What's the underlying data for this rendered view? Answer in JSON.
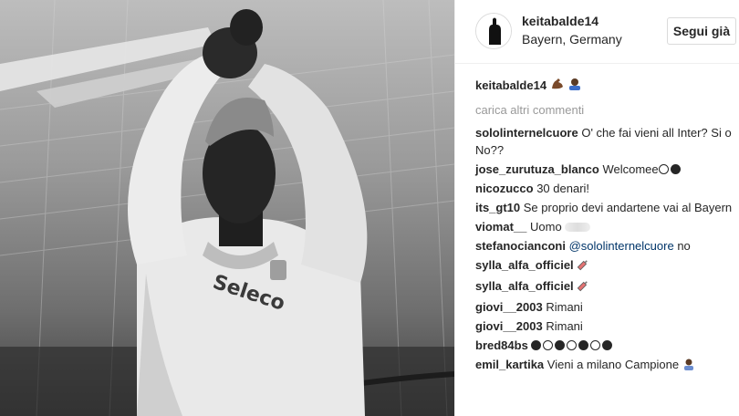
{
  "post": {
    "username": "keitabalde14",
    "location": "Bayern, Germany",
    "follow_label": "Segui già"
  },
  "caption": {
    "username": "keitabalde14",
    "emoji_1": "flexed-biceps-emoji",
    "emoji_2": "person-bowing-emoji"
  },
  "load_more_label": "carica altri commenti",
  "comments": [
    {
      "user": "sololinternelcuore",
      "text": "O' che fai vieni all Inter? Si o No??"
    },
    {
      "user": "jose_zurutuza_blanco",
      "text": "Welcomee"
    },
    {
      "user": "nicozucco",
      "text": "30 denari!"
    },
    {
      "user": "its_gt10",
      "text": "Se proprio devi andartene vai al Bayern"
    },
    {
      "user": "viomat__",
      "text": "Uomo"
    },
    {
      "user": "stefanocianconi",
      "mention": "@sololinternelcuore",
      "text": "no"
    },
    {
      "user": "sylla_alfa_officiel",
      "text": ""
    },
    {
      "user": "sylla_alfa_officiel",
      "text": ""
    },
    {
      "user": "giovi__2003",
      "text": "Rimani"
    },
    {
      "user": "giovi__2003",
      "text": "Rimani"
    },
    {
      "user": "bred84bs",
      "text": ""
    },
    {
      "user": "emil_kartika",
      "text": "Vieni a milano Campione"
    }
  ],
  "photo_text": {
    "shirt_brand": "Seleco"
  },
  "colors": {
    "text": "#262626",
    "muted": "#999999",
    "mention": "#003569",
    "border": "#dbdbdb"
  }
}
